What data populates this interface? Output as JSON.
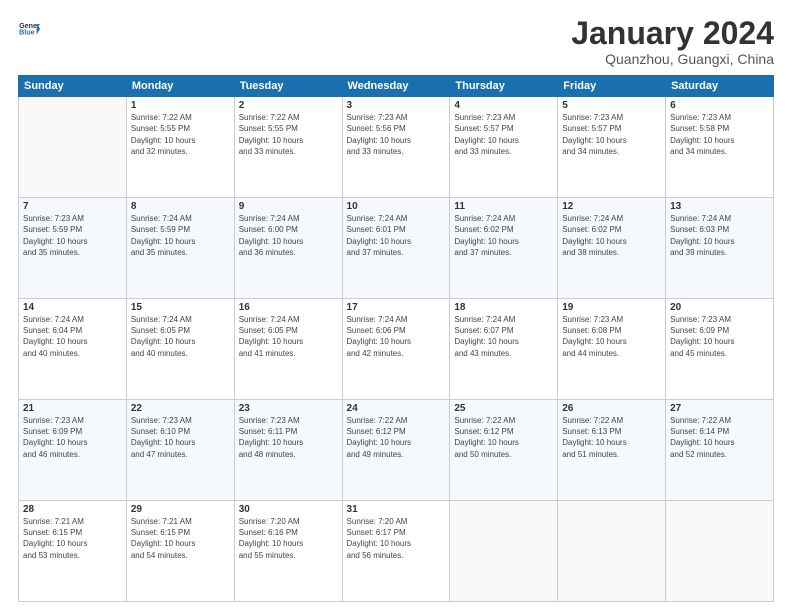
{
  "logo": {
    "line1": "General",
    "line2": "Blue",
    "icon": "▶"
  },
  "title": "January 2024",
  "subtitle": "Quanzhou, Guangxi, China",
  "headers": [
    "Sunday",
    "Monday",
    "Tuesday",
    "Wednesday",
    "Thursday",
    "Friday",
    "Saturday"
  ],
  "weeks": [
    [
      {
        "num": "",
        "info": ""
      },
      {
        "num": "1",
        "info": "Sunrise: 7:22 AM\nSunset: 5:55 PM\nDaylight: 10 hours\nand 32 minutes."
      },
      {
        "num": "2",
        "info": "Sunrise: 7:22 AM\nSunset: 5:55 PM\nDaylight: 10 hours\nand 33 minutes."
      },
      {
        "num": "3",
        "info": "Sunrise: 7:23 AM\nSunset: 5:56 PM\nDaylight: 10 hours\nand 33 minutes."
      },
      {
        "num": "4",
        "info": "Sunrise: 7:23 AM\nSunset: 5:57 PM\nDaylight: 10 hours\nand 33 minutes."
      },
      {
        "num": "5",
        "info": "Sunrise: 7:23 AM\nSunset: 5:57 PM\nDaylight: 10 hours\nand 34 minutes."
      },
      {
        "num": "6",
        "info": "Sunrise: 7:23 AM\nSunset: 5:58 PM\nDaylight: 10 hours\nand 34 minutes."
      }
    ],
    [
      {
        "num": "7",
        "info": "Sunrise: 7:23 AM\nSunset: 5:59 PM\nDaylight: 10 hours\nand 35 minutes."
      },
      {
        "num": "8",
        "info": "Sunrise: 7:24 AM\nSunset: 5:59 PM\nDaylight: 10 hours\nand 35 minutes."
      },
      {
        "num": "9",
        "info": "Sunrise: 7:24 AM\nSunset: 6:00 PM\nDaylight: 10 hours\nand 36 minutes."
      },
      {
        "num": "10",
        "info": "Sunrise: 7:24 AM\nSunset: 6:01 PM\nDaylight: 10 hours\nand 37 minutes."
      },
      {
        "num": "11",
        "info": "Sunrise: 7:24 AM\nSunset: 6:02 PM\nDaylight: 10 hours\nand 37 minutes."
      },
      {
        "num": "12",
        "info": "Sunrise: 7:24 AM\nSunset: 6:02 PM\nDaylight: 10 hours\nand 38 minutes."
      },
      {
        "num": "13",
        "info": "Sunrise: 7:24 AM\nSunset: 6:03 PM\nDaylight: 10 hours\nand 39 minutes."
      }
    ],
    [
      {
        "num": "14",
        "info": "Sunrise: 7:24 AM\nSunset: 6:04 PM\nDaylight: 10 hours\nand 40 minutes."
      },
      {
        "num": "15",
        "info": "Sunrise: 7:24 AM\nSunset: 6:05 PM\nDaylight: 10 hours\nand 40 minutes."
      },
      {
        "num": "16",
        "info": "Sunrise: 7:24 AM\nSunset: 6:05 PM\nDaylight: 10 hours\nand 41 minutes."
      },
      {
        "num": "17",
        "info": "Sunrise: 7:24 AM\nSunset: 6:06 PM\nDaylight: 10 hours\nand 42 minutes."
      },
      {
        "num": "18",
        "info": "Sunrise: 7:24 AM\nSunset: 6:07 PM\nDaylight: 10 hours\nand 43 minutes."
      },
      {
        "num": "19",
        "info": "Sunrise: 7:23 AM\nSunset: 6:08 PM\nDaylight: 10 hours\nand 44 minutes."
      },
      {
        "num": "20",
        "info": "Sunrise: 7:23 AM\nSunset: 6:09 PM\nDaylight: 10 hours\nand 45 minutes."
      }
    ],
    [
      {
        "num": "21",
        "info": "Sunrise: 7:23 AM\nSunset: 6:09 PM\nDaylight: 10 hours\nand 46 minutes."
      },
      {
        "num": "22",
        "info": "Sunrise: 7:23 AM\nSunset: 6:10 PM\nDaylight: 10 hours\nand 47 minutes."
      },
      {
        "num": "23",
        "info": "Sunrise: 7:23 AM\nSunset: 6:11 PM\nDaylight: 10 hours\nand 48 minutes."
      },
      {
        "num": "24",
        "info": "Sunrise: 7:22 AM\nSunset: 6:12 PM\nDaylight: 10 hours\nand 49 minutes."
      },
      {
        "num": "25",
        "info": "Sunrise: 7:22 AM\nSunset: 6:12 PM\nDaylight: 10 hours\nand 50 minutes."
      },
      {
        "num": "26",
        "info": "Sunrise: 7:22 AM\nSunset: 6:13 PM\nDaylight: 10 hours\nand 51 minutes."
      },
      {
        "num": "27",
        "info": "Sunrise: 7:22 AM\nSunset: 6:14 PM\nDaylight: 10 hours\nand 52 minutes."
      }
    ],
    [
      {
        "num": "28",
        "info": "Sunrise: 7:21 AM\nSunset: 6:15 PM\nDaylight: 10 hours\nand 53 minutes."
      },
      {
        "num": "29",
        "info": "Sunrise: 7:21 AM\nSunset: 6:15 PM\nDaylight: 10 hours\nand 54 minutes."
      },
      {
        "num": "30",
        "info": "Sunrise: 7:20 AM\nSunset: 6:16 PM\nDaylight: 10 hours\nand 55 minutes."
      },
      {
        "num": "31",
        "info": "Sunrise: 7:20 AM\nSunset: 6:17 PM\nDaylight: 10 hours\nand 56 minutes."
      },
      {
        "num": "",
        "info": ""
      },
      {
        "num": "",
        "info": ""
      },
      {
        "num": "",
        "info": ""
      }
    ]
  ]
}
